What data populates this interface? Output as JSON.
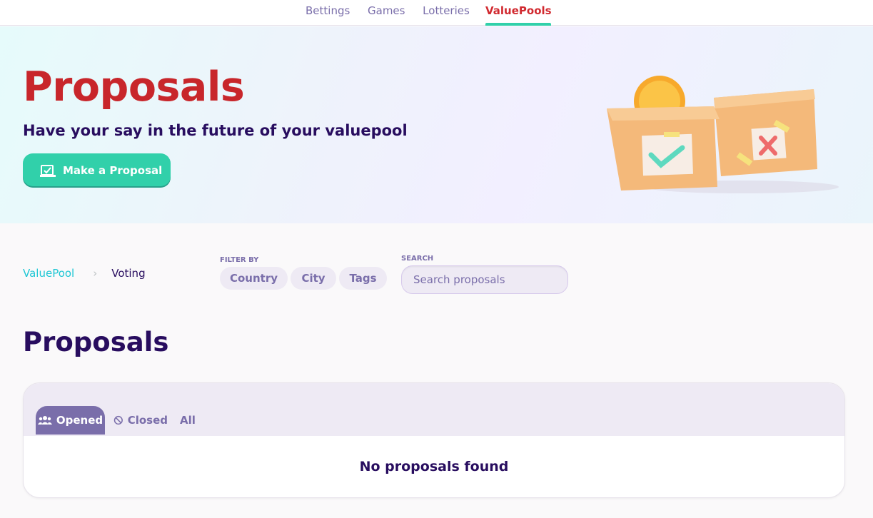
{
  "nav": {
    "tabs": [
      {
        "label": "Bettings",
        "active": false
      },
      {
        "label": "Games",
        "active": false
      },
      {
        "label": "Lotteries",
        "active": false
      },
      {
        "label": "ValuePools",
        "active": true
      }
    ]
  },
  "hero": {
    "title": "Proposals",
    "subtitle": "Have your say in the future of your valuepool",
    "button_label": "Make a Proposal",
    "button_icon": "vote-icon",
    "illustration": "ballot-boxes-illustration"
  },
  "breadcrumb": {
    "items": [
      "ValuePool",
      "Voting"
    ],
    "separator_icon": "chevron-right-icon"
  },
  "filters": {
    "label": "FILTER BY",
    "chips": [
      "Country",
      "City",
      "Tags"
    ]
  },
  "search": {
    "label": "SEARCH",
    "placeholder": "Search proposals",
    "value": ""
  },
  "main": {
    "title": "Proposals",
    "tabs": [
      {
        "label": "Opened",
        "icon": "group-icon",
        "active": true
      },
      {
        "label": "Closed",
        "icon": "block-icon",
        "active": false
      },
      {
        "label": "All",
        "icon": "",
        "active": false
      }
    ],
    "empty_message": "No proposals found"
  },
  "colors": {
    "accent": "#31d0aa",
    "brand_red": "#c8262b",
    "text": "#280d5f",
    "secondary": "#7a6eaa",
    "link": "#1fc7d4"
  }
}
